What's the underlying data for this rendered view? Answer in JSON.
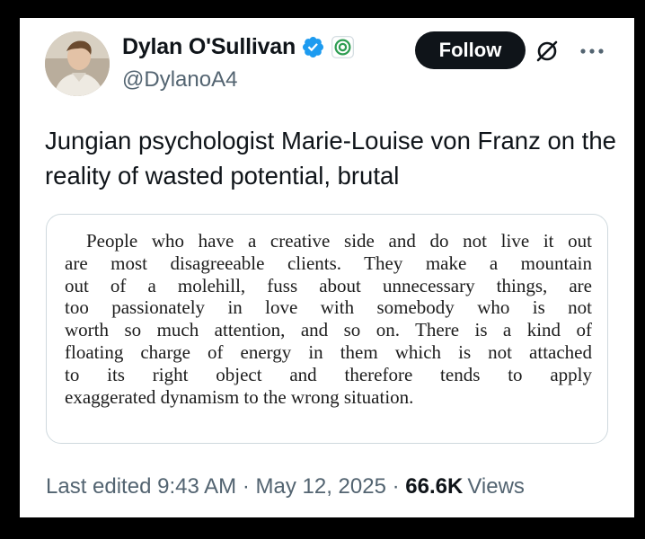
{
  "author": {
    "display_name": "Dylan O'Sullivan",
    "handle": "@DylanoA4",
    "verified_badge_icon": "verified-badge-icon",
    "affiliate_badge_icon": "affiliate-badge-icon",
    "badge_color": "#1d9bf0"
  },
  "actions": {
    "follow_label": "Follow",
    "grok_icon": "grok-icon",
    "more_icon": "more-options-icon"
  },
  "tweet": {
    "text": "Jungian psychologist Marie-Louise von Franz on the reality of wasted potential, brutal",
    "quote_lines": [
      "People who have a creative side and do not live it out",
      "are most disagreeable clients. They make a mountain",
      "out of a molehill, fuss about unnecessary things, are",
      "too passionately in love with somebody who is not",
      "worth so much attention, and so on. There is a kind of",
      "floating charge of energy in them which is not attached",
      "to its right object and therefore tends to apply",
      "exaggerated dynamism to the wrong situation."
    ]
  },
  "meta": {
    "edited_label": "Last edited",
    "time": "9:43 AM",
    "date": "May 12, 2025",
    "separator": "·",
    "views_count": "66.6K",
    "views_label": "Views"
  }
}
